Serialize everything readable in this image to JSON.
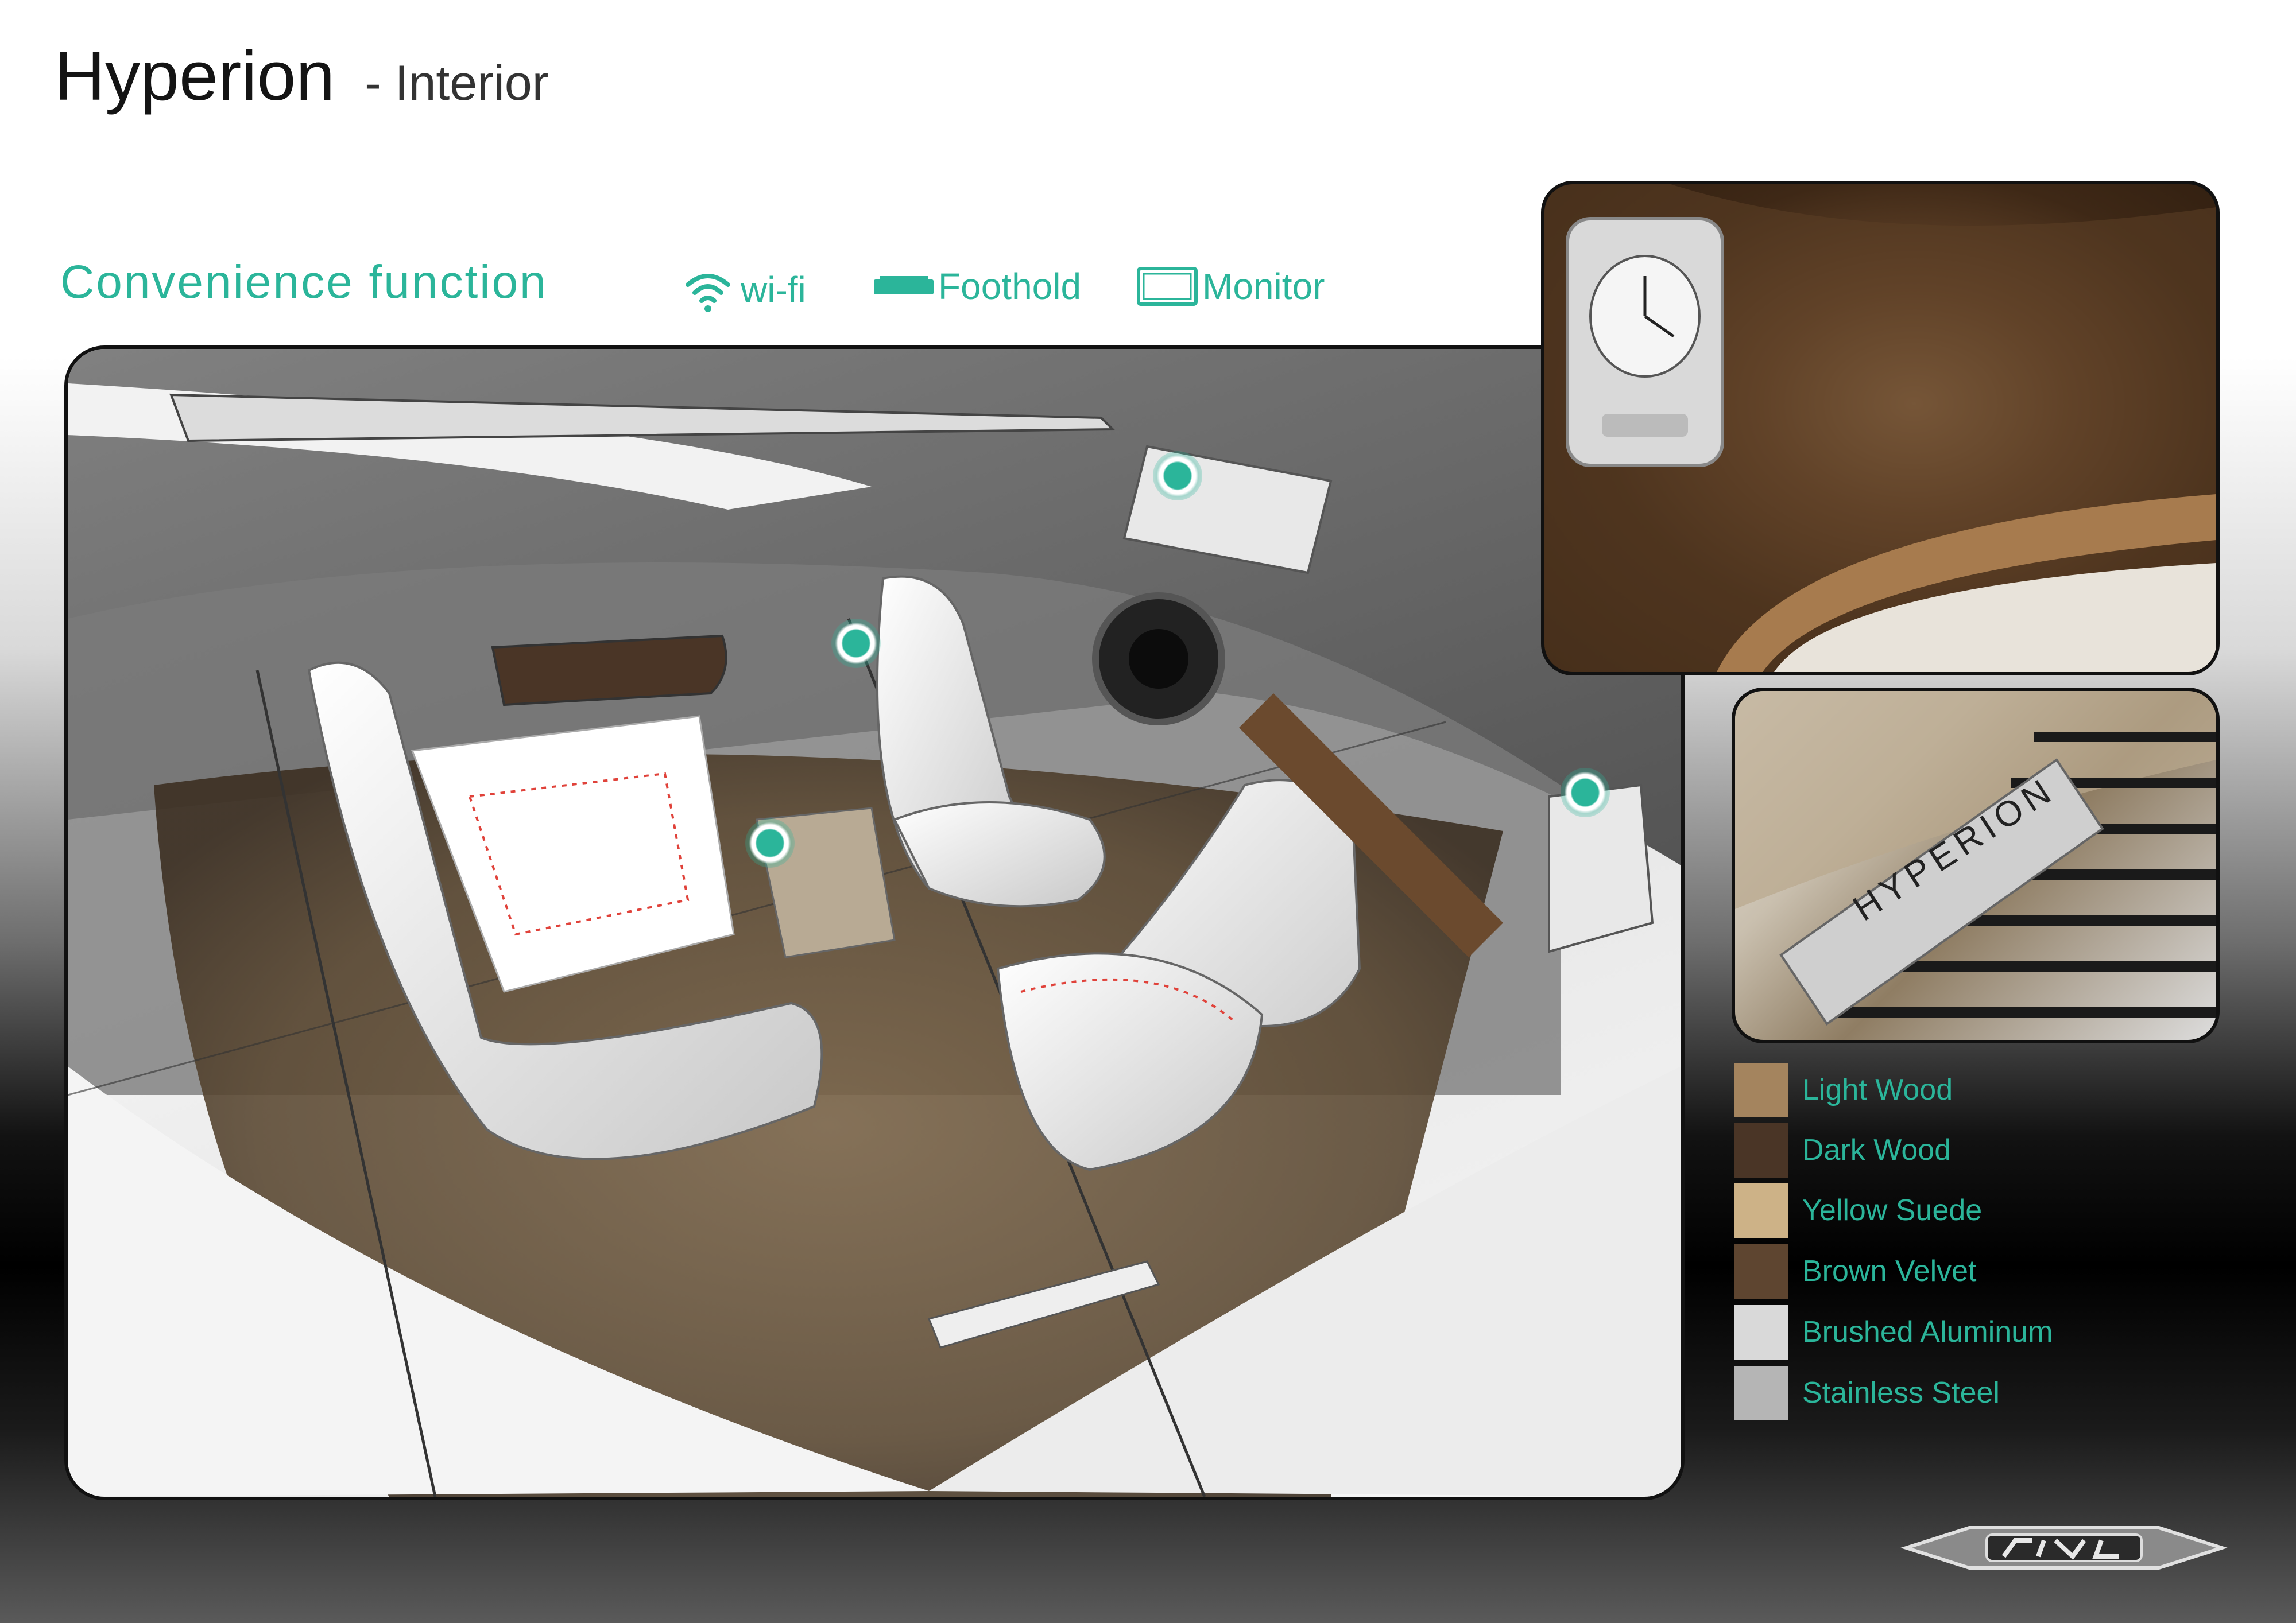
{
  "title": {
    "main": "Hyperion",
    "sub": "- Interior"
  },
  "convenience": {
    "title": "Convenience function",
    "legend": [
      {
        "icon": "wifi-icon",
        "label": "wi-fi"
      },
      {
        "icon": "foothold-icon",
        "label": "Foothold"
      },
      {
        "icon": "monitor-icon",
        "label": "Monitor"
      }
    ]
  },
  "materials": [
    {
      "label": "Light Wood",
      "color": "#a4845e"
    },
    {
      "label": "Dark Wood",
      "color": "#4a3526"
    },
    {
      "label": "Yellow Suede",
      "color": "#cdb287"
    },
    {
      "label": "Brown Velvet",
      "color": "#5e4530"
    },
    {
      "label": "Brushed Aluminum",
      "color": "#d9d9d9"
    },
    {
      "label": "Stainless Steel",
      "color": "#b5b5b5"
    }
  ],
  "sill_plate_text": "HYPERION",
  "colors": {
    "accent": "#2bb59a"
  }
}
